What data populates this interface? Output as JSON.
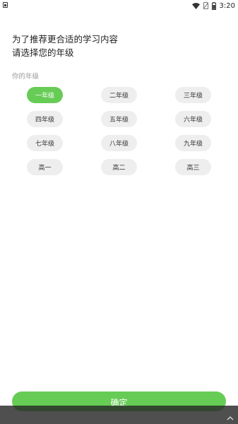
{
  "status_bar": {
    "time": "3:20"
  },
  "heading": {
    "line1": "为了推荐更合适的学习内容",
    "line2": "请选择您的年级"
  },
  "section_label": "你的年级",
  "grades": [
    {
      "label": "一年级",
      "selected": true
    },
    {
      "label": "二年级",
      "selected": false
    },
    {
      "label": "三年级",
      "selected": false
    },
    {
      "label": "四年级",
      "selected": false
    },
    {
      "label": "五年级",
      "selected": false
    },
    {
      "label": "六年级",
      "selected": false
    },
    {
      "label": "七年级",
      "selected": false
    },
    {
      "label": "八年级",
      "selected": false
    },
    {
      "label": "九年级",
      "selected": false
    },
    {
      "label": "高一",
      "selected": false
    },
    {
      "label": "高二",
      "selected": false
    },
    {
      "label": "高三",
      "selected": false
    }
  ],
  "confirm_label": "确定",
  "colors": {
    "accent": "#66cc55",
    "chip_bg": "#eeeeee"
  },
  "icons": {
    "status_left": "notification-icon",
    "wifi": "wifi-icon",
    "no_sim": "no-sim-icon",
    "battery": "battery-icon",
    "expand": "chevron-up-icon"
  }
}
